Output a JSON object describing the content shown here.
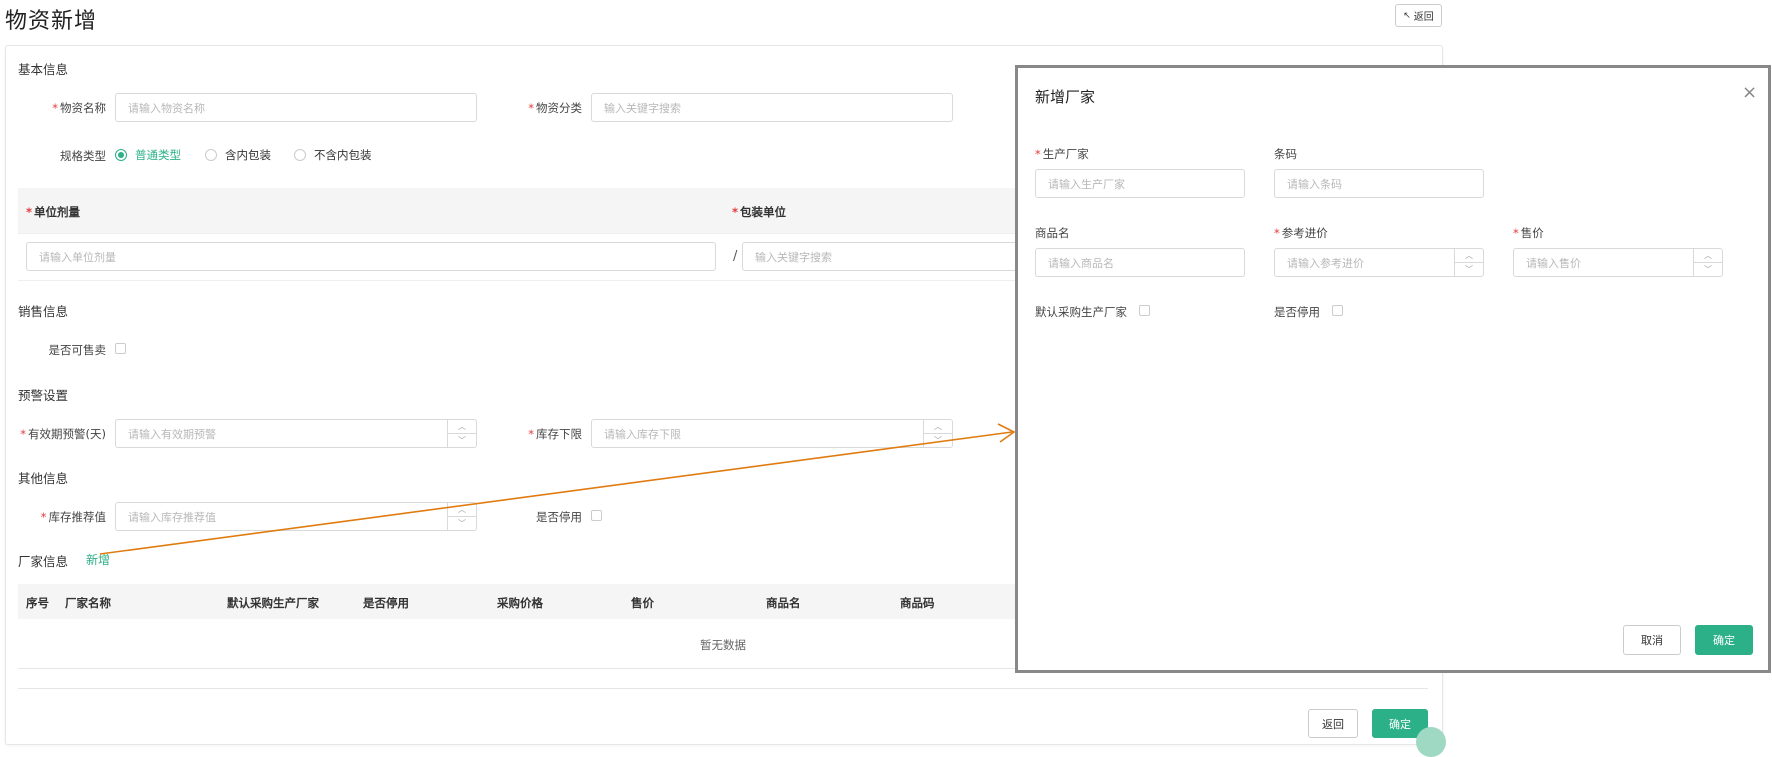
{
  "page": {
    "title": "物资新增",
    "back_top": "返回"
  },
  "basic": {
    "title": "基本信息",
    "name_label": "物资名称",
    "name_placeholder": "请输入物资名称",
    "category_label": "物资分类",
    "category_placeholder": "输入关键字搜索",
    "spec_label": "规格类型",
    "spec_options": [
      "普通类型",
      "含内包装",
      "不含内包装"
    ],
    "spec_selected": "普通类型"
  },
  "unit_table": {
    "dose_header": "单位剂量",
    "pack_header": "包装单位",
    "dose_placeholder": "请输入单位剂量",
    "separator": "/",
    "pack_placeholder": "输入关键字搜索"
  },
  "sales": {
    "title": "销售信息",
    "sellable_label": "是否可售卖"
  },
  "alert": {
    "title": "预警设置",
    "expiry_label": "有效期预警(天)",
    "expiry_placeholder": "请输入有效期预警",
    "stock_min_label": "库存下限",
    "stock_min_placeholder": "请输入库存下限"
  },
  "other": {
    "title": "其他信息",
    "stock_recommend_label": "库存推荐值",
    "stock_recommend_placeholder": "请输入库存推荐值",
    "disabled_label": "是否停用"
  },
  "vendor": {
    "title": "厂家信息",
    "add_link": "新增",
    "columns": [
      "序号",
      "厂家名称",
      "默认采购生产厂家",
      "是否停用",
      "采购价格",
      "售价",
      "商品名",
      "商品码"
    ],
    "empty_text": "暂无数据"
  },
  "footer": {
    "back": "返回",
    "confirm": "确定"
  },
  "modal": {
    "title": "新增厂家",
    "close": "×",
    "manufacturer_label": "生产厂家",
    "manufacturer_placeholder": "请输入生产厂家",
    "barcode_label": "条码",
    "barcode_placeholder": "请输入条码",
    "trade_name_label": "商品名",
    "trade_name_placeholder": "请输入商品名",
    "ref_price_label": "参考进价",
    "ref_price_placeholder": "请输入参考进价",
    "sale_price_label": "售价",
    "sale_price_placeholder": "请输入售价",
    "default_mfr_label": "默认采购生产厂家",
    "disabled_label": "是否停用",
    "cancel": "取消",
    "confirm": "确定"
  },
  "colors": {
    "accent": "#2bb087",
    "required": "#e4393c",
    "arrow": "#e07b10"
  }
}
